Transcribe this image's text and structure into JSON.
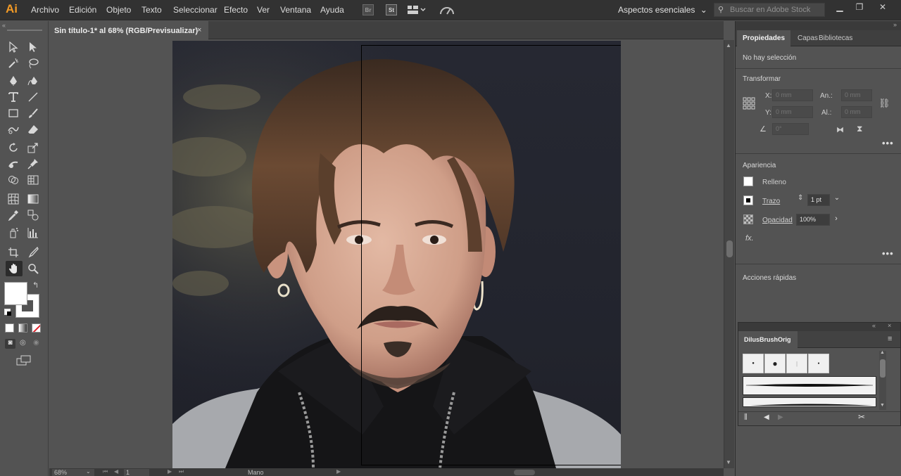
{
  "app": {
    "logo": "Ai"
  },
  "menubar": {
    "items": [
      "Archivo",
      "Edición",
      "Objeto",
      "Texto",
      "Seleccionar",
      "Efecto",
      "Ver",
      "Ventana",
      "Ayuda"
    ],
    "bridge_icon": "Br",
    "stock_icon": "St",
    "workspace": "Aspectos esenciales",
    "search_placeholder": "Buscar en Adobe Stock"
  },
  "document": {
    "tab_title": "Sin título-1* al 68% (RGB/Previsualizar)",
    "close_glyph": "×"
  },
  "statusbar": {
    "zoom": "68%",
    "artboard_number": "1",
    "tool_name": "Mano"
  },
  "panels": {
    "tabs": [
      "Propiedades",
      "Capas",
      "Bibliotecas"
    ],
    "no_selection": "No hay selección",
    "transform": {
      "title": "Transformar",
      "x_label": "X:",
      "x_value": "0 mm",
      "y_label": "Y:",
      "y_value": "0 mm",
      "w_label": "An.:",
      "w_value": "0 mm",
      "h_label": "Al.:",
      "h_value": "0 mm",
      "angle_value": "0°"
    },
    "appearance": {
      "title": "Apariencia",
      "fill_label": "Relleno",
      "stroke_label": "Trazo",
      "stroke_weight": "1 pt",
      "opacity_label": "Opacidad",
      "opacity_value": "100%",
      "fx_label": "fx."
    },
    "quick_actions": {
      "title": "Acciones rápidas"
    },
    "brushes": {
      "title": "DilusBrushOrig"
    }
  },
  "colors": {
    "menubar_bg": "#323232",
    "workspace_bg": "#535353",
    "accent_logo": "#f29a26",
    "fill_swatch": "#ffffff",
    "stroke_swatch": "#000000"
  },
  "icons": {
    "toolbar": [
      "selection-tool",
      "direct-selection-tool",
      "magic-wand-tool",
      "lasso-tool",
      "pen-tool",
      "curvature-tool",
      "type-tool",
      "line-tool",
      "rectangle-tool",
      "paintbrush-tool",
      "shaper-tool",
      "eraser-tool",
      "rotate-tool",
      "scale-tool",
      "warp-tool",
      "puppet-warp-tool",
      "shape-builder-tool",
      "perspective-tool",
      "mesh-tool",
      "gradient-tool",
      "eyedropper-tool",
      "blend-tool",
      "symbol-sprayer-tool",
      "column-graph-tool",
      "artboard-tool",
      "slice-tool",
      "hand-tool",
      "zoom-tool"
    ]
  }
}
